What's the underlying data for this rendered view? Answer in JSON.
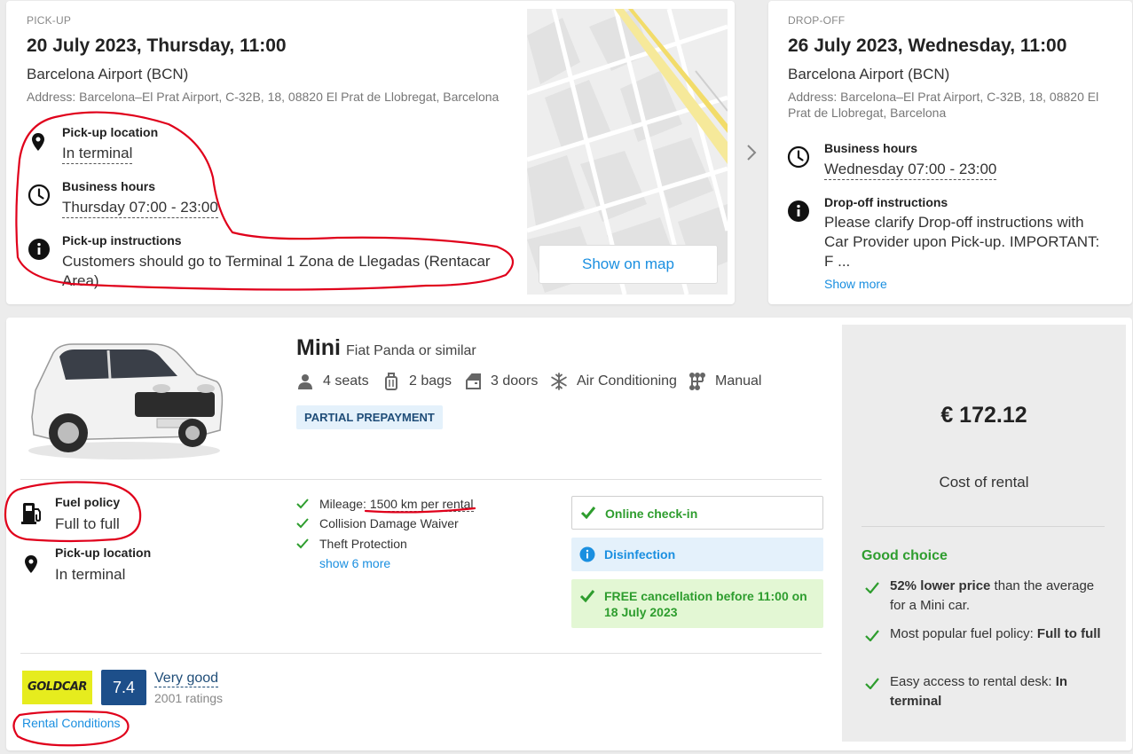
{
  "pickup": {
    "section_label": "PICK-UP",
    "datetime": "20 July 2023, Thursday, 11:00",
    "location_name": "Barcelona Airport (BCN)",
    "address": "Address: Barcelona–El Prat Airport, C-32B, 18, 08820 El Prat de Llobregat, Barcelona",
    "location": {
      "title": "Pick-up location",
      "value": "In terminal"
    },
    "hours": {
      "title": "Business hours",
      "value": "Thursday 07:00 - 23:00"
    },
    "instructions": {
      "title": "Pick-up instructions",
      "value_line1": "Customers should go to Terminal 1 Zona de Llegadas (Rentacar",
      "value_line2": "Area)"
    },
    "map_button": "Show on map"
  },
  "dropoff": {
    "section_label": "DROP-OFF",
    "datetime": "26 July 2023, Wednesday, 11:00",
    "location_name": "Barcelona Airport (BCN)",
    "address_line1": "Address: Barcelona–El Prat Airport, C-32B, 18, 08820 El",
    "address_line2": "Prat de Llobregat, Barcelona",
    "hours": {
      "title": "Business hours",
      "value": "Wednesday 07:00 - 23:00"
    },
    "instructions": {
      "title": "Drop-off instructions",
      "line1": "Please clarify Drop-off instructions with",
      "line2": "Car Provider upon Pick-up. IMPORTANT:",
      "line3": "F ..."
    },
    "show_more": "Show more"
  },
  "car": {
    "category": "Mini",
    "model": "Fiat Panda or similar",
    "features": {
      "seats": "4 seats",
      "bags": "2 bags",
      "doors": "3 doors",
      "ac": "Air Conditioning",
      "transmission": "Manual"
    },
    "badge": "PARTIAL PREPAYMENT",
    "fuel": {
      "title": "Fuel policy",
      "value": "Full to full"
    },
    "pickup_location": {
      "title": "Pick-up location",
      "value": "In terminal"
    },
    "inclusions": {
      "mileage_prefix": "Mileage: ",
      "mileage_value": "1500 km per rental",
      "cdw": "Collision Damage Waiver",
      "theft": "Theft Protection",
      "show_more": "show 6 more"
    },
    "status": {
      "checkin": "Online check-in",
      "disinfection": "Disinfection",
      "cancel_line1": "FREE cancellation before 11:00 on",
      "cancel_line2": "18 July 2023"
    },
    "supplier": {
      "logo_text": "GOLDCAR",
      "score": "7.4",
      "rating_label": "Very good",
      "rating_count": "2001 ratings",
      "rental_conditions": "Rental Conditions"
    }
  },
  "price_panel": {
    "price": "€ 172.12",
    "price_label": "Cost of rental",
    "good_title": "Good choice",
    "item1_bold": "52% lower price",
    "item1_rest": " than the average for a Mini car.",
    "item2_prefix": "Most popular fuel policy: ",
    "item2_bold": "Full to full",
    "item3_prefix": "Easy access to rental desk: ",
    "item3_bold": "In terminal"
  },
  "colors": {
    "accent_blue": "#1a8fe0",
    "green": "#2e9d2e",
    "annotation_red": "#e0001b",
    "score_bg": "#1d4f8a",
    "goldcar_yellow": "#e6ec1e"
  }
}
